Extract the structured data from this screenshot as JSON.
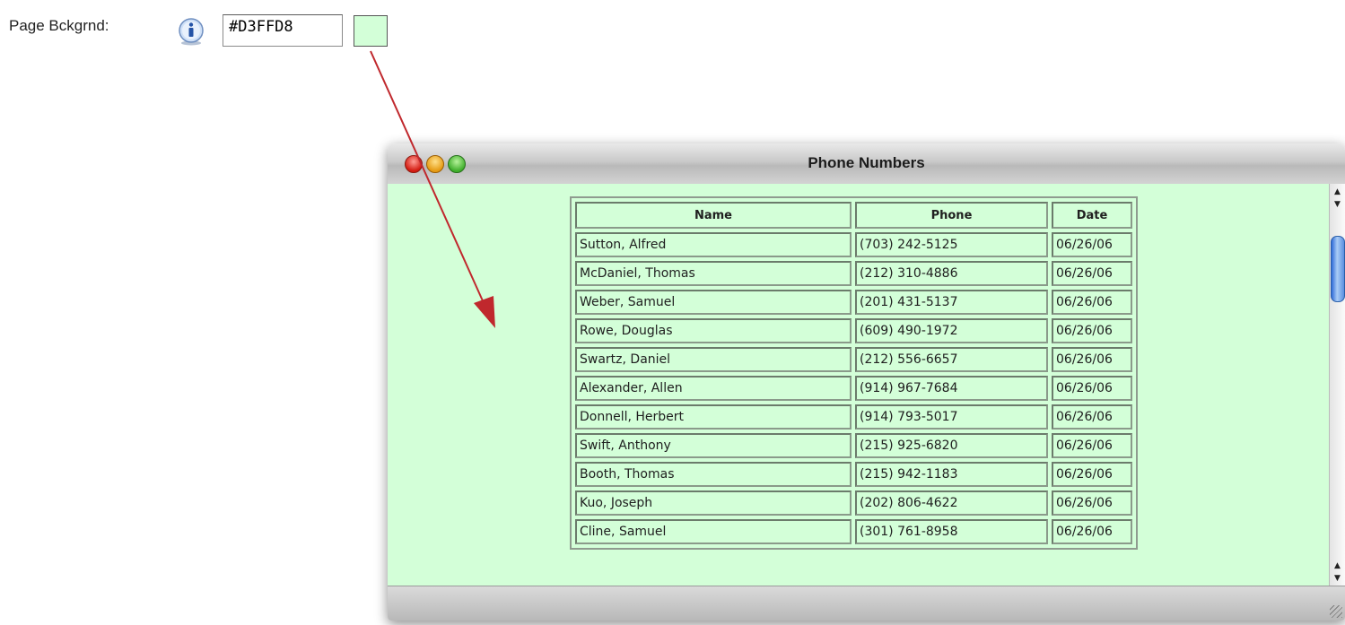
{
  "control": {
    "label": "Page Bckgrnd:",
    "hex_value": "#D3FFD8",
    "swatch_color": "#D3FFD8",
    "info_icon": "info-icon"
  },
  "window": {
    "title": "Phone Numbers",
    "background": "#D3FFD8"
  },
  "table": {
    "headers": [
      "Name",
      "Phone",
      "Date"
    ],
    "rows": [
      {
        "name": "Sutton, Alfred",
        "phone": "(703) 242-5125",
        "date": "06/26/06"
      },
      {
        "name": "McDaniel, Thomas",
        "phone": "(212) 310-4886",
        "date": "06/26/06"
      },
      {
        "name": "Weber, Samuel",
        "phone": "(201) 431-5137",
        "date": "06/26/06"
      },
      {
        "name": "Rowe, Douglas",
        "phone": "(609) 490-1972",
        "date": "06/26/06"
      },
      {
        "name": "Swartz, Daniel",
        "phone": "(212) 556-6657",
        "date": "06/26/06"
      },
      {
        "name": "Alexander, Allen",
        "phone": "(914) 967-7684",
        "date": "06/26/06"
      },
      {
        "name": "Donnell, Herbert",
        "phone": "(914) 793-5017",
        "date": "06/26/06"
      },
      {
        "name": "Swift, Anthony",
        "phone": "(215) 925-6820",
        "date": "06/26/06"
      },
      {
        "name": "Booth, Thomas",
        "phone": "(215) 942-1183",
        "date": "06/26/06"
      },
      {
        "name": "Kuo, Joseph",
        "phone": "(202) 806-4622",
        "date": "06/26/06"
      },
      {
        "name": "Cline, Samuel",
        "phone": "(301) 761-8958",
        "date": "06/26/06"
      }
    ]
  },
  "colors": {
    "arrow": "#c0282d"
  }
}
